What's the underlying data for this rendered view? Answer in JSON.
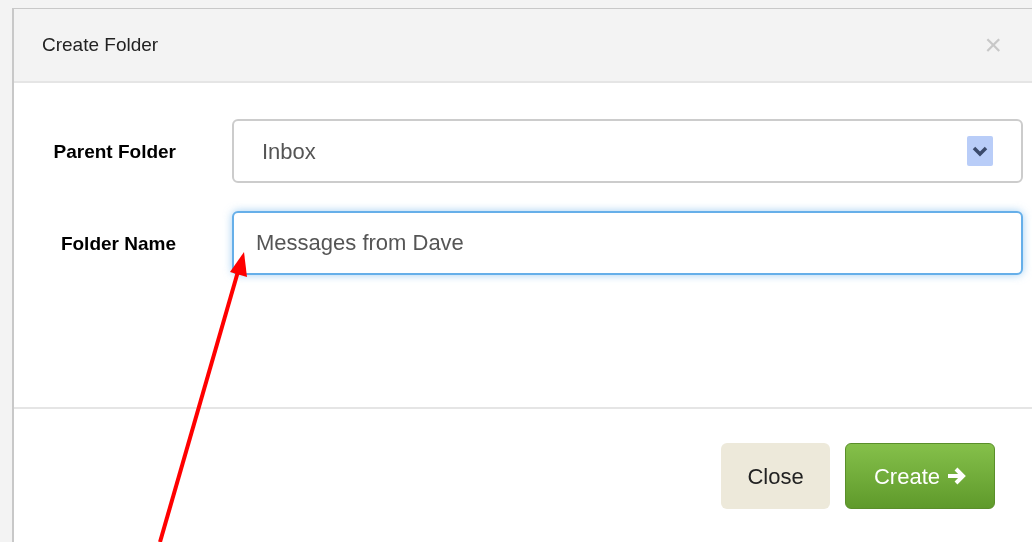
{
  "dialog": {
    "title": "Create Folder",
    "close_glyph": "×"
  },
  "fields": [
    {
      "kind": "select",
      "label": "Parent Folder",
      "value": "Inbox",
      "focused": false
    },
    {
      "kind": "text",
      "label": "Folder Name",
      "value": "Messages from Dave",
      "focused": true
    }
  ],
  "buttons": [
    {
      "kind": "secondary",
      "label": "Close"
    },
    {
      "kind": "primary",
      "label": "Create"
    }
  ]
}
